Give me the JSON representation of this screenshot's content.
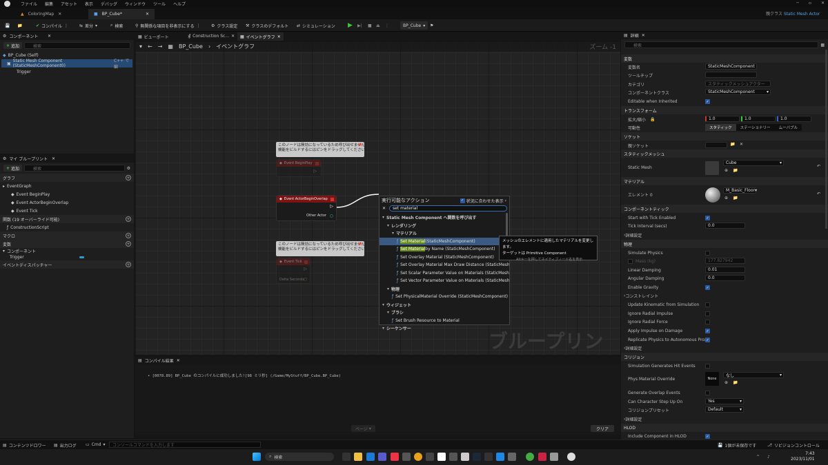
{
  "titlebar": {
    "menu": [
      "ファイル",
      "編集",
      "アセット",
      "表示",
      "デバッグ",
      "ウィンドウ",
      "ツール",
      "ヘルプ"
    ],
    "parent_class_label": "親クラス",
    "parent_class_value": "Static Mesh Actor"
  },
  "doc_tabs": [
    "ColoringMap",
    "BP_Cube*"
  ],
  "toolbar": {
    "compile": "コンパイル",
    "diff": "差分",
    "search": "検索",
    "hide_unrelated": "無関係な項目を非表示にする",
    "class_settings": "クラス設定",
    "class_defaults": "クラスのデフォルト",
    "simulation": "シミュレーション",
    "debug_object": "BP_Cube"
  },
  "components": {
    "title": "コンポーネント",
    "add": "追加",
    "search_placeholder": "検索",
    "self": "BP_Cube (Self)",
    "static_mesh": "Static Mesh Component (StaticMeshComponent0)",
    "cpp": "C++ で編",
    "trigger": "Trigger"
  },
  "my_blueprint": {
    "title": "マイ ブループリント",
    "add": "追加",
    "search_placeholder": "検索",
    "sections": {
      "graph": "グラフ",
      "functions": "関数 (19 オーバーライド可能)",
      "macros": "マクロ",
      "variables": "変数",
      "components_cat": "コンポーネント",
      "dispatchers": "イベントディスパッチャー"
    },
    "event_graph": "EventGraph",
    "events": [
      "Event BeginPlay",
      "Event ActorBeginOverlap",
      "Event Tick"
    ],
    "construction": "ConstructionScript",
    "var_trigger": "Trigger"
  },
  "graph_tabs": [
    "ビューポート",
    "Construction Sc...",
    "イベントグラフ"
  ],
  "graph": {
    "breadcrumb_bp": "BP_Cube",
    "breadcrumb_graph": "イベントグラフ",
    "zoom": "ズーム -1",
    "watermark": "ブループリント",
    "comment": "このノードは無効になっているため呼び出せません。\n機能をビルドするにはピンをドラッグしてください。",
    "node_beginplay": "Event BeginPlay",
    "node_overlap": "Event ActorBeginOverlap",
    "other_actor": "Other Actor",
    "node_tick": "Event Tick",
    "delta": "Delta Seconds"
  },
  "context_menu": {
    "title": "実行可能なアクション",
    "context_sensitive": "状況に合わせた表示",
    "search_value": "set material",
    "items": [
      {
        "t": "Static Mesh Component へ関数を呼び出す",
        "k": "cat",
        "i": 0
      },
      {
        "t": "レンダリング",
        "k": "cat",
        "i": 1
      },
      {
        "t": "マテリアル",
        "k": "cat",
        "i": 2
      },
      {
        "t": "(StaticMeshComponent)",
        "k": "fn",
        "i": 3,
        "hl": "Set Material",
        "sel": true
      },
      {
        "t": " by Name (StaticMeshComponent)",
        "k": "fn",
        "i": 3,
        "hl": "Set Material"
      },
      {
        "t": "Set Overlay Material (StaticMeshComponent)",
        "k": "fn",
        "i": 3
      },
      {
        "t": "Set Overlay Material Max Draw Distance (StaticMesh",
        "k": "fn",
        "i": 3
      },
      {
        "t": "Set Scalar Parameter Value on Materials (StaticMesh",
        "k": "fn",
        "i": 3
      },
      {
        "t": "Set Vector Parameter Value on Materials (StaticMesh",
        "k": "fn",
        "i": 3
      },
      {
        "t": "物理",
        "k": "cat",
        "i": 1
      },
      {
        "t": "Set PhysicalMaterial Override (StaticMeshComponent)",
        "k": "fn",
        "i": 2
      },
      {
        "t": "ウィジェット",
        "k": "cat",
        "i": 0
      },
      {
        "t": "ブラシ",
        "k": "cat",
        "i": 1
      },
      {
        "t": "Set Brush Resource to Material",
        "k": "fn",
        "i": 2
      },
      {
        "t": "シーケンサー",
        "k": "cat",
        "i": 0
      }
    ]
  },
  "tooltip": {
    "line1": "メッシュのエレメントに適用したマテリアルを変更します。",
    "line2": "ターゲットは Primitive Component",
    "line3": "Altキーを押してネイティブノード名を表示"
  },
  "compiler": {
    "title": "コンパイル結果",
    "message": "[0078.89] BP_Cube のコンパイルに成功しました![98 ミリ秒] (/Game/MyStuff/BP_Cube.BP_Cube)",
    "page": "ページ",
    "clear": "クリア"
  },
  "details": {
    "title": "詳細",
    "search_placeholder": "検索",
    "sec_variable": "変数",
    "var_name_label": "変数名",
    "var_name": "StaticMeshComponent",
    "tooltip_label": "ツールチップ",
    "category_label": "カテゴリ",
    "category_value": "スタティックメッシュアクター",
    "comp_class_label": "コンポーネントクラス",
    "comp_class": "StaticMeshComponent",
    "editable_inherited": "Editable when Inherited",
    "sec_transform": "トランスフォーム",
    "scale_label": "拡大/縮小",
    "scale_x": "1.0",
    "scale_y": "1.0",
    "scale_z": "1.0",
    "mobility_label": "可動性",
    "mob_static": "スタティック",
    "mob_stationary": "ステーショナリー",
    "mob_movable": "ムーバブル",
    "sec_socket": "ソケット",
    "parent_socket": "親ソケット",
    "sec_static_mesh": "スタティックメッシュ",
    "static_mesh_label": "Static Mesh",
    "static_mesh_value": "Cube",
    "sec_materials": "マテリアル",
    "element0": "エレメント 0",
    "material_value": "M_Basic_Floor",
    "sec_tick": "コンポーネントティック",
    "start_tick": "Start with Tick Enabled",
    "tick_interval": "Tick Interval (secs)",
    "tick_interval_val": "0.0",
    "advanced": "詳細設定",
    "sec_physics": "物理",
    "simulate_physics": "Simulate Physics",
    "mass": "Mass (kg)",
    "mass_val": "177.827942",
    "linear_damping": "Linear Damping",
    "linear_val": "0.01",
    "angular_damping": "Angular Damping",
    "angular_val": "0.0",
    "enable_gravity": "Enable Gravity",
    "constraints": "コンストレイント",
    "update_kinematic": "Update Kinematic from Simulation",
    "ignore_radial_impulse": "Ignore Radial Impulse",
    "ignore_radial_force": "Ignore Radial Force",
    "apply_impulse": "Apply Impulse on Damage",
    "replicate_physics": "Replicate Physics to Autonomous Proxy",
    "advanced2": "詳細設定",
    "sec_collision": "コリジョン",
    "sim_hit_events": "Simulation Generates Hit Events",
    "phys_mat_override": "Phys Material Override",
    "none_label": "None",
    "none_value": "なし",
    "gen_overlap": "Generate Overlap Events",
    "can_step": "Can Character Step Up On",
    "can_step_val": "Yes",
    "collision_presets": "コリジョンプリセット",
    "collision_presets_val": "Default",
    "advanced3": "詳細設定",
    "sec_hlod": "HLOD",
    "include_hlod": "Include Component in HLOD"
  },
  "statusbar": {
    "content_drawer": "コンテンツドロワー",
    "output_log": "出力ログ",
    "cmd": "Cmd",
    "console_placeholder": "コンソールコマンドを入力します",
    "unsaved": "1個が未保存です",
    "revision": "リビジョンコントロール"
  },
  "taskbar": {
    "search": "検索",
    "time": "7:43",
    "date": "2023/11/01"
  }
}
